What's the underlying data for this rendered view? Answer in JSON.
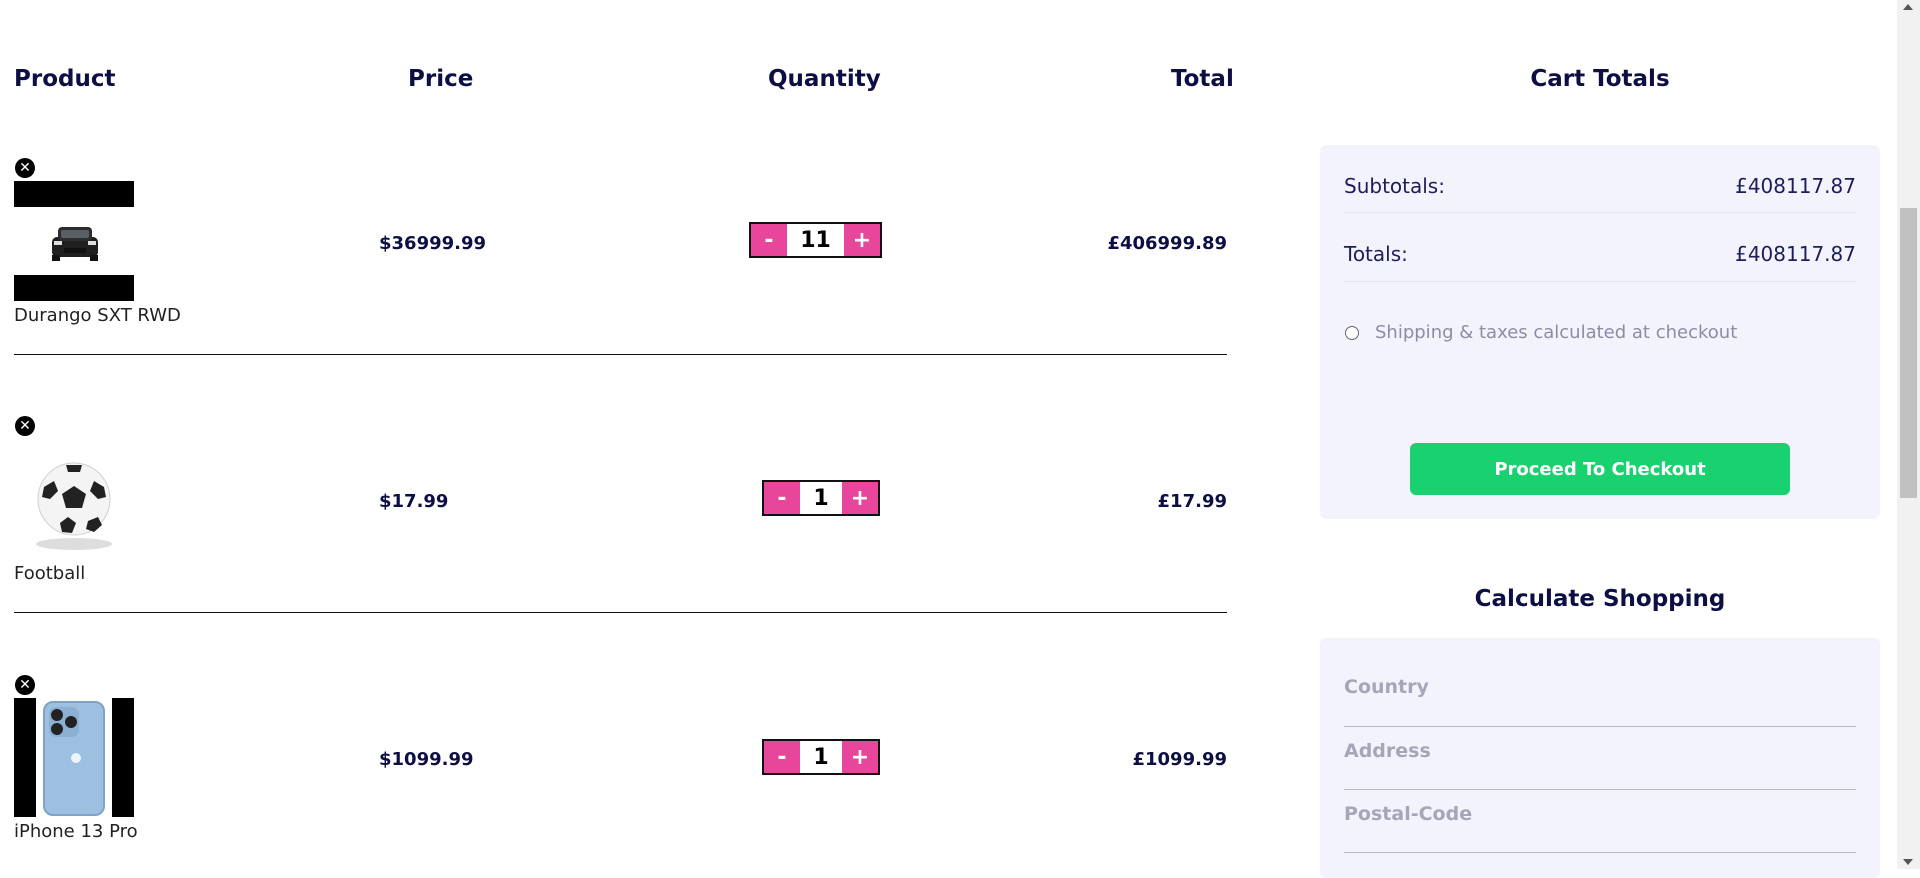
{
  "table": {
    "headers": {
      "product": "Product",
      "price": "Price",
      "quantity": "Quantity",
      "total": "Total"
    },
    "rows": [
      {
        "name": "Durango SXT RWD",
        "price": "$36999.99",
        "quantity": "11",
        "total": "£406999.89",
        "image": "car-image"
      },
      {
        "name": "Football",
        "price": "$17.99",
        "quantity": "1",
        "total": "£17.99",
        "image": "football-image"
      },
      {
        "name": "iPhone 13 Pro",
        "price": "$1099.99",
        "quantity": "1",
        "total": "£1099.99",
        "image": "phone-image"
      }
    ],
    "decrement_label": "-",
    "increment_label": "+",
    "remove_icon": "close-circle-icon"
  },
  "cart_totals": {
    "title": "Cart Totals",
    "subtotals_label": "Subtotals:",
    "subtotals_value": "£408117.87",
    "totals_label": "Totals:",
    "totals_value": "£408117.87",
    "shipping_note": "Shipping & taxes calculated at checkout",
    "checkout_button": "Proceed To Checkout"
  },
  "calculate": {
    "title": "Calculate Shopping",
    "country_placeholder": "Country",
    "address_placeholder": "Address",
    "postal_placeholder": "Postal-Code"
  },
  "colors": {
    "accent_pink": "#e8469a",
    "checkout_green": "#19d16f",
    "navy": "#0d0e43",
    "panel_bg": "#f2f3fd"
  }
}
